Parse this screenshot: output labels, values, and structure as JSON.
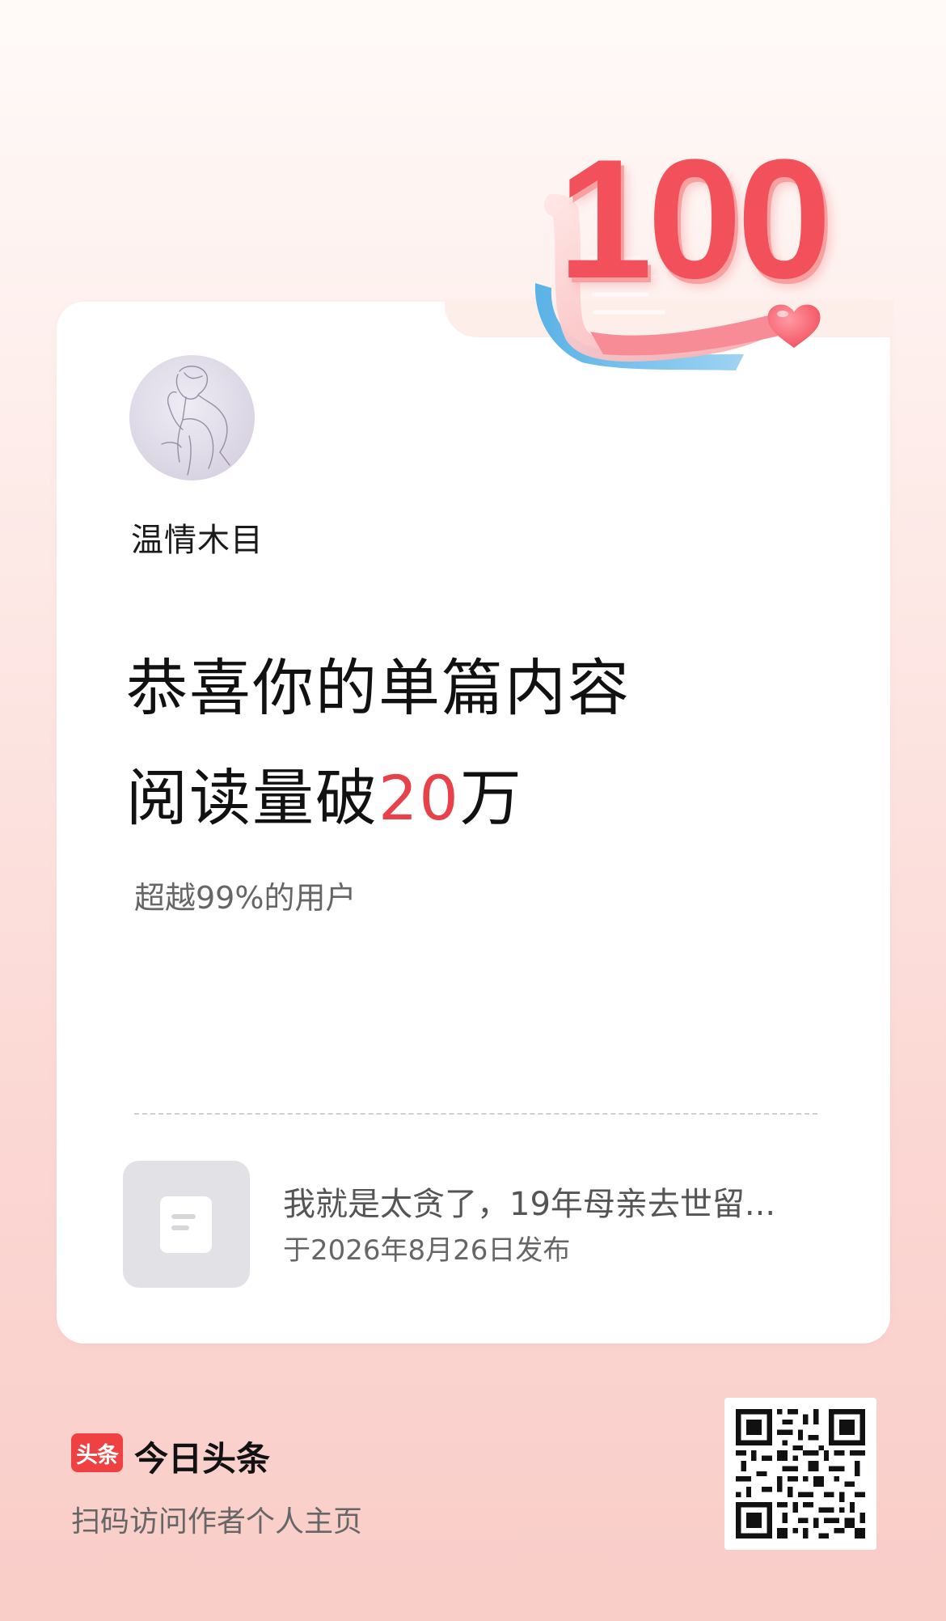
{
  "badge": {
    "number": "100"
  },
  "author": {
    "name": "温情木目"
  },
  "headline": {
    "line1": "恭喜你的单篇内容",
    "line2_prefix": "阅读量破",
    "line2_number": "20",
    "line2_suffix": "万"
  },
  "subtitle": "超越99%的用户",
  "article": {
    "title": "我就是太贪了，19年母亲去世留...",
    "date": "于2026年8月26日发布"
  },
  "footer": {
    "logo_text": "头条",
    "brand_name": "今日头条",
    "scan_hint": "扫码访问作者个人主页"
  },
  "colors": {
    "accent": "#e8414a",
    "logo": "#f04142",
    "background_top": "#fffaf8",
    "background_bottom": "#f9cdc8"
  }
}
